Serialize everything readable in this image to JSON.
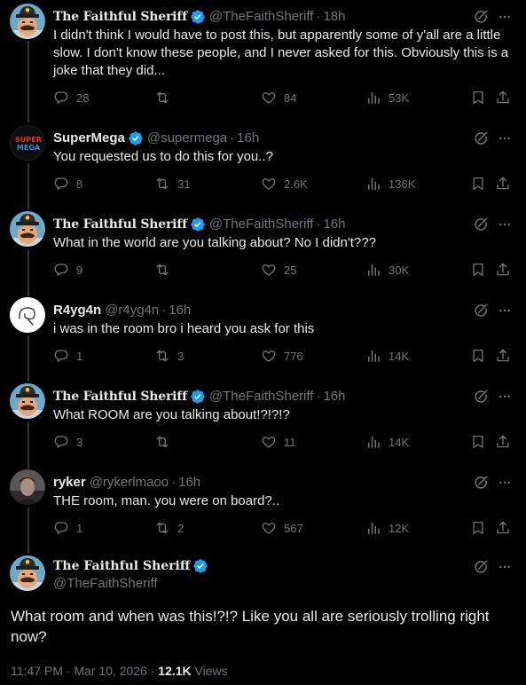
{
  "colors": {
    "background": "#000000",
    "text": "#e7e9ea",
    "muted": "#71767b",
    "verified": "#1d9bf0",
    "line": "#333639"
  },
  "tweets": [
    {
      "name": "The Faithful Sheriff",
      "handle": "@TheFaithSheriff",
      "time": "18h",
      "text": "I didn't think I would have to post this, but apparently some of y'all are a little slow. I don't know these people, and I never asked for this. Obviously this is a joke that they did...",
      "replies": "28",
      "reposts": "",
      "likes": "84",
      "views": "53K",
      "avatar": "sheriff",
      "verified": true
    },
    {
      "name": "SuperMega",
      "handle": "@supermega",
      "time": "16h",
      "text": "You requested us to do this for you..?",
      "replies": "8",
      "reposts": "31",
      "likes": "2.6K",
      "views": "136K",
      "avatar": "supermega",
      "avatar_text_top": "SUPER",
      "avatar_text_bottom": "MEGA",
      "verified": true
    },
    {
      "name": "The Faithful Sheriff",
      "handle": "@TheFaithSheriff",
      "time": "16h",
      "text": "What in the world are you talking about? No I didn't???",
      "replies": "9",
      "reposts": "",
      "likes": "25",
      "views": "30K",
      "avatar": "sheriff",
      "verified": true
    },
    {
      "name": "R4yg4n",
      "handle": "@r4yg4n",
      "time": "16h",
      "text": "i was in the room bro i heard you ask for this",
      "replies": "1",
      "reposts": "3",
      "likes": "776",
      "views": "14K",
      "avatar": "r4yg4n",
      "verified": false
    },
    {
      "name": "The Faithful Sheriff",
      "handle": "@TheFaithSheriff",
      "time": "16h",
      "text": "What ROOM are you talking about!?!?!?",
      "replies": "3",
      "reposts": "",
      "likes": "11",
      "views": "14K",
      "avatar": "sheriff",
      "verified": true
    },
    {
      "name": "ryker",
      "handle": "@rykerlmaoo",
      "time": "16h",
      "text": "THE room, man. you were on board?..",
      "replies": "1",
      "reposts": "2",
      "likes": "567",
      "views": "12K",
      "avatar": "ryker",
      "verified": false
    }
  ],
  "focus": {
    "name": "The Faithful Sheriff",
    "handle": "@TheFaithSheriff",
    "text": "What room and when was this!?!? Like you all are seriously trolling right now?",
    "time": "11:47 PM",
    "date": "Mar 10, 2026",
    "views_count": "12.1K",
    "views_label": "Views",
    "verified": true
  },
  "icons": [
    "grok-icon",
    "more-icon",
    "reply-icon",
    "repost-icon",
    "like-icon",
    "views-icon",
    "bookmark-icon",
    "share-icon",
    "verified-icon"
  ]
}
